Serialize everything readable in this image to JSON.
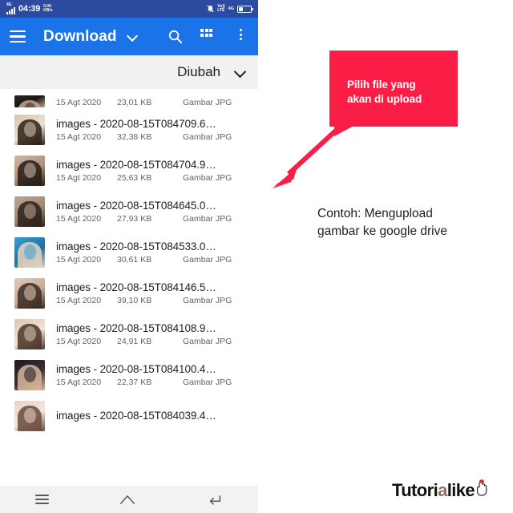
{
  "phone": {
    "status_bar": {
      "network_label": "4G",
      "time": "04:39",
      "data_speed_value": "0.00",
      "data_speed_unit": "KB/s",
      "mute_icon": "bell-muted-icon",
      "volte_line1": "Vo))",
      "volte_line2": "LTE",
      "second_network_label": "4G",
      "battery_icon": "battery-icon",
      "background_color": "#2b4aa0"
    },
    "app_bar": {
      "menu_icon": "hamburger-menu-icon",
      "title": "Download",
      "dropdown_icon": "chevron-down-icon",
      "search_icon": "search-icon",
      "grid_view_icon": "grid-view-icon",
      "overflow_icon": "more-vertical-icon",
      "background_color": "#1a73e8"
    },
    "sort_bar": {
      "label": "Diubah",
      "chevron_icon": "chevron-down-icon",
      "background_color": "#f1f1f1"
    },
    "file_list": [
      {
        "name": "",
        "date": "15 Agt 2020",
        "size": "23,01 KB",
        "type": "Gambar JPG",
        "clipped": true
      },
      {
        "name": "images - 2020-08-15T084709.6…",
        "date": "15 Agt 2020",
        "size": "32,38 KB",
        "type": "Gambar JPG",
        "clipped": false
      },
      {
        "name": "images - 2020-08-15T084704.9…",
        "date": "15 Agt 2020",
        "size": "25,63 KB",
        "type": "Gambar JPG",
        "clipped": false
      },
      {
        "name": "images - 2020-08-15T084645.0…",
        "date": "15 Agt 2020",
        "size": "27,93 KB",
        "type": "Gambar JPG",
        "clipped": false
      },
      {
        "name": "images - 2020-08-15T084533.0…",
        "date": "15 Agt 2020",
        "size": "30,61 KB",
        "type": "Gambar JPG",
        "clipped": false
      },
      {
        "name": "images - 2020-08-15T084146.5…",
        "date": "15 Agt 2020",
        "size": "39,10 KB",
        "type": "Gambar JPG",
        "clipped": false
      },
      {
        "name": "images - 2020-08-15T084108.9…",
        "date": "15 Agt 2020",
        "size": "24,91 KB",
        "type": "Gambar JPG",
        "clipped": false
      },
      {
        "name": "images - 2020-08-15T084100.4…",
        "date": "15 Agt 2020",
        "size": "22,37 KB",
        "type": "Gambar JPG",
        "clipped": false
      },
      {
        "name": "images - 2020-08-15T084039.4…",
        "date": "",
        "size": "",
        "type": "",
        "clipped": false
      }
    ],
    "nav_bar": {
      "recents_icon": "recents-icon",
      "home_icon": "home-icon",
      "back_icon": "back-icon",
      "background_color": "#f2f2f2"
    }
  },
  "annotation": {
    "callout": {
      "line1": "Pilih file yang",
      "line2": "akan di upload",
      "color": "#fa1e46"
    },
    "arrow_icon": "arrow-down-left-icon",
    "caption_line1": "Contoh: Mengupload",
    "caption_line2": "gambar ke google drive"
  },
  "watermark": {
    "part1": "Tutori",
    "part2": "a",
    "part3": "like",
    "hand_icon": "pointing-hand-icon"
  }
}
